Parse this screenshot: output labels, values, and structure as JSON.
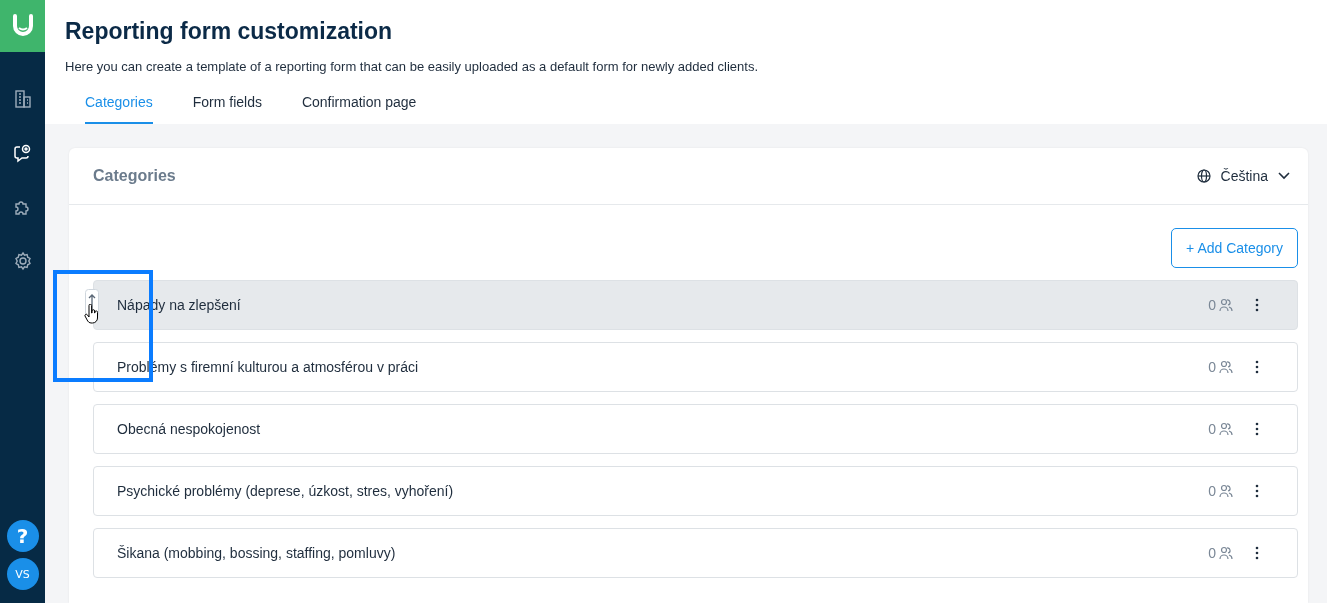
{
  "sidebar": {
    "items": [
      {
        "selected": false
      },
      {
        "selected": true
      },
      {
        "selected": false
      },
      {
        "selected": false
      }
    ],
    "help": "?",
    "avatar": "VS"
  },
  "header": {
    "title": "Reporting form customization",
    "subtitle": "Here you can create a template of a reporting form that can be easily uploaded as a default form for newly added clients."
  },
  "tabs": [
    {
      "label": "Categories",
      "selected": true
    },
    {
      "label": "Form fields",
      "selected": false
    },
    {
      "label": "Confirmation page",
      "selected": false
    }
  ],
  "card": {
    "title": "Categories",
    "language": "Čeština",
    "add_button": "+ Add Category",
    "rows": [
      {
        "name": "Nápady na zlepšení",
        "count": "0",
        "dragging": true
      },
      {
        "name": "Problémy s firemní kulturou a atmosférou v práci",
        "count": "0",
        "dragging": false
      },
      {
        "name": "Obecná nespokojenost",
        "count": "0",
        "dragging": false
      },
      {
        "name": "Psychické problémy (deprese, úzkost, stres, vyhoření)",
        "count": "0",
        "dragging": false
      },
      {
        "name": "Šikana (mobbing, bossing, staffing, pomluvy)",
        "count": "0",
        "dragging": false
      }
    ]
  }
}
